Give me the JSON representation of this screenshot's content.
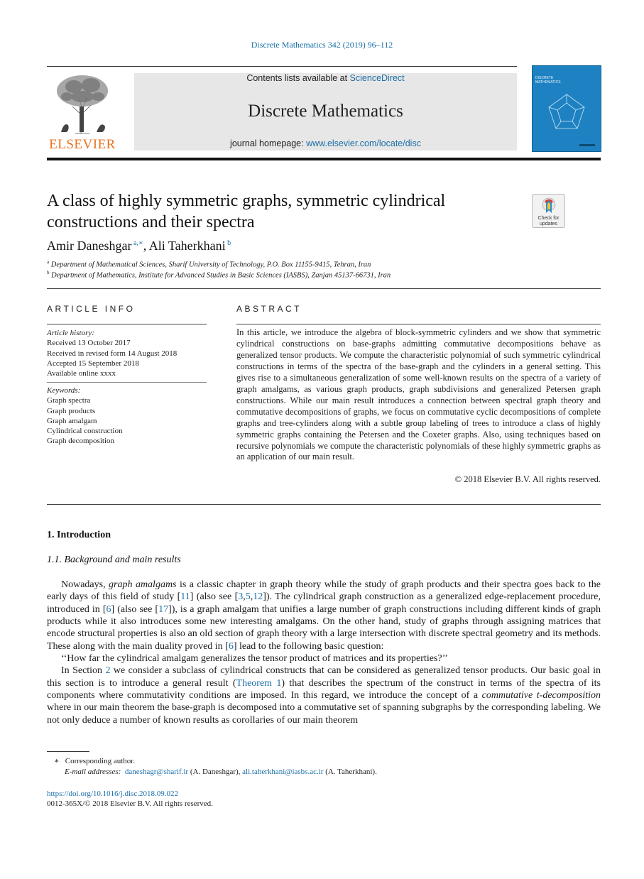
{
  "running_head": "Discrete Mathematics 342 (2019) 96–112",
  "masthead": {
    "publisher_logo_text": "ELSEVIER",
    "contents_prefix": "Contents lists available at ",
    "contents_link": "ScienceDirect",
    "journal_name": "Discrete Mathematics",
    "homepage_prefix": "journal homepage: ",
    "homepage_link": "www.elsevier.com/locate/disc",
    "cover_title_line1": "DISCRETE",
    "cover_title_line2": "MATHEMATICS",
    "accent_color": "#e9711c",
    "cover_color": "#1e82c2"
  },
  "crossmark": {
    "line1": "Check for",
    "line2": "updates"
  },
  "article": {
    "title_line1": "A class of highly symmetric graphs, symmetric cylindrical",
    "title_line2": "constructions and their spectra",
    "authors": [
      {
        "name": "Amir Daneshgar",
        "sup": "a,∗"
      },
      {
        "name": "Ali Taherkhani",
        "sup": "b"
      }
    ],
    "author_separator": ", ",
    "affiliations": [
      {
        "mark": "a",
        "text": "Department of Mathematical Sciences, Sharif University of Technology, P.O. Box 11155-9415, Tehran, Iran"
      },
      {
        "mark": "b",
        "text": "Department of Mathematics, Institute for Advanced Studies in Basic Sciences (IASBS), Zanjan  45137-66731, Iran"
      }
    ]
  },
  "article_info": {
    "heading": "ARTICLE INFO",
    "history_label": "Article history:",
    "history": [
      "Received 13 October 2017",
      "Received in revised form 14 August 2018",
      "Accepted 15 September 2018",
      "Available online  xxxx"
    ],
    "keywords_label": "Keywords:",
    "keywords": [
      "Graph spectra",
      "Graph products",
      "Graph amalgam",
      "Cylindrical construction",
      "Graph decomposition"
    ]
  },
  "abstract": {
    "heading": "ABSTRACT",
    "text": "In this article, we introduce the algebra of block-symmetric cylinders and we show that symmetric cylindrical constructions on base-graphs admitting commutative decompositions behave as generalized tensor products. We compute the characteristic polynomial of such symmetric cylindrical constructions in terms of the spectra of the base-graph and the cylinders in a general setting. This gives rise to a simultaneous generalization of some well-known results on the spectra of a variety of graph amalgams, as various graph products, graph subdivisions and generalized Petersen graph constructions. While our main result introduces a connection between spectral graph theory and commutative decompositions of graphs, we focus on commutative cyclic decompositions of complete graphs and tree-cylinders along with a subtle group labeling of trees to introduce a class of highly symmetric graphs containing the Petersen and the Coxeter graphs. Also, using techniques based on recursive polynomials we compute the characteristic polynomials of these highly symmetric graphs as an application of our main result.",
    "copyright": "© 2018 Elsevier B.V. All rights reserved."
  },
  "section1": {
    "heading": "1.  Introduction",
    "subheading": "1.1.  Background and main results",
    "p1": {
      "s1": "Nowadays, ",
      "em1": "graph amalgams",
      "s2": " is a classic chapter in graph theory while the study of graph products and their spectra goes back to the early days of this field of study [",
      "ref11": "11",
      "s3": "] (also see [",
      "ref3": "3",
      "c1": ",",
      "ref5": "5",
      "c2": ",",
      "ref12": "12",
      "s4": "]). The cylindrical graph construction as a generalized edge-replacement procedure, introduced in [",
      "ref6a": "6",
      "s5": "] (also see [",
      "ref17": "17",
      "s6": "]), is a graph amalgam that unifies a large number of graph constructions including different kinds of graph products while it also introduces some new interesting amalgams. On the other hand, study of graphs through assigning matrices that encode structural properties is also an old section of graph theory with a large intersection with discrete spectral geometry and its methods. These along with the main duality proved in [",
      "ref6b": "6",
      "s7": "] lead to the following basic question:"
    },
    "p2": "‘‘How far the cylindrical amalgam generalizes the tensor product of matrices and its properties?’’",
    "p3": {
      "s1": "In Section ",
      "ref_sec2": "2",
      "s2": " we consider a subclass of cylindrical constructs that can be considered as generalized tensor products. Our basic goal in this section is to introduce a general result (",
      "ref_thm1": "Theorem 1",
      "s3": ") that describes the spectrum of the construct in terms of the spectra of its components where commutativity conditions are imposed. In this regard, we introduce the concept of a ",
      "em1": "commutative t-decomposition",
      "s4": " where in our main theorem the base-graph is decomposed into a commutative set of spanning subgraphs by the corresponding labeling. We not only deduce a number of known results as corollaries of our main theorem"
    }
  },
  "footnotes": {
    "star": "∗",
    "corresponding": "Corresponding author.",
    "email_label": "E-mail addresses:",
    "email1": "daneshagr@sharif.ir",
    "email1_owner": " (A. Daneshgar), ",
    "email2": "ali.taherkhani@iasbs.ac.ir",
    "email2_owner": " (A. Taherkhani)."
  },
  "doi": "https://doi.org/10.1016/j.disc.2018.09.022",
  "issn_line": "0012-365X/© 2018 Elsevier B.V. All rights reserved."
}
